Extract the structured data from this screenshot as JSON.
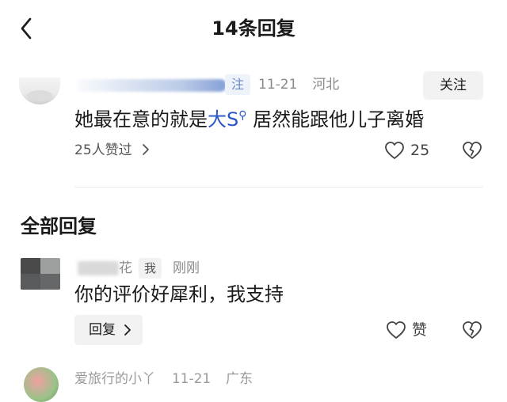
{
  "header": {
    "title": "14条回复"
  },
  "main_comment": {
    "follow_tag": "注",
    "date": "11-21",
    "location": "河北",
    "follow_button": "关注",
    "text_before": "她最在意的就是",
    "link_text": "大S",
    "link_icon": "search-mini-icon",
    "text_after": " 居然能跟他儿子离婚",
    "likes_summary": "25人赞过",
    "like_count": "25"
  },
  "replies_section": {
    "title": "全部回复",
    "reply": {
      "name_partial": "花",
      "me_tag": "我",
      "time": "刚刚",
      "text": "你的评价好犀利，我支持",
      "reply_button": "回复",
      "like_label": "赞"
    },
    "next": {
      "name": "爱旅行的小丫",
      "date": "11-21",
      "location": "广东"
    }
  },
  "colors": {
    "link": "#2a55c9",
    "muted": "#8a8a8a",
    "chip_bg": "#f2f2f2"
  }
}
